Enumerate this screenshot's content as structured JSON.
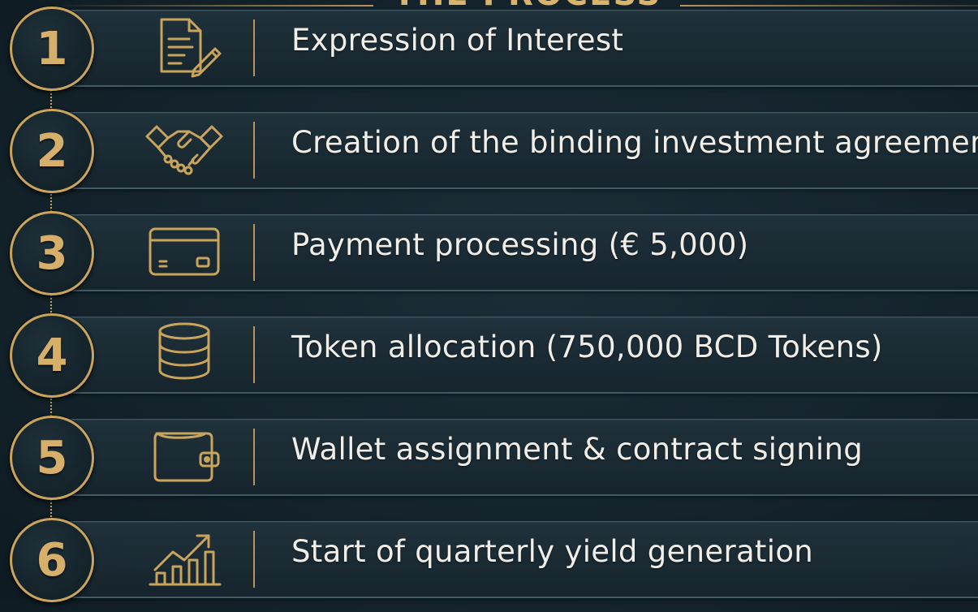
{
  "header": {
    "title": "THE PROCESS"
  },
  "steps": [
    {
      "number": "1",
      "label": "Expression of Interest",
      "icon": "document-pencil-icon"
    },
    {
      "number": "2",
      "label": "Creation of the binding investment agreement",
      "icon": "handshake-icon"
    },
    {
      "number": "3",
      "label": "Payment processing (€ 5,000)",
      "icon": "credit-card-icon"
    },
    {
      "number": "4",
      "label": "Token allocation (750,000 BCD Tokens)",
      "icon": "coin-stack-icon"
    },
    {
      "number": "5",
      "label": "Wallet assignment & contract signing",
      "icon": "wallet-icon"
    },
    {
      "number": "6",
      "label": "Start of quarterly yield generation",
      "icon": "growth-chart-icon"
    }
  ],
  "colors": {
    "accent": "#c9a45c",
    "background": "#14232c",
    "text": "#f1eee8"
  }
}
